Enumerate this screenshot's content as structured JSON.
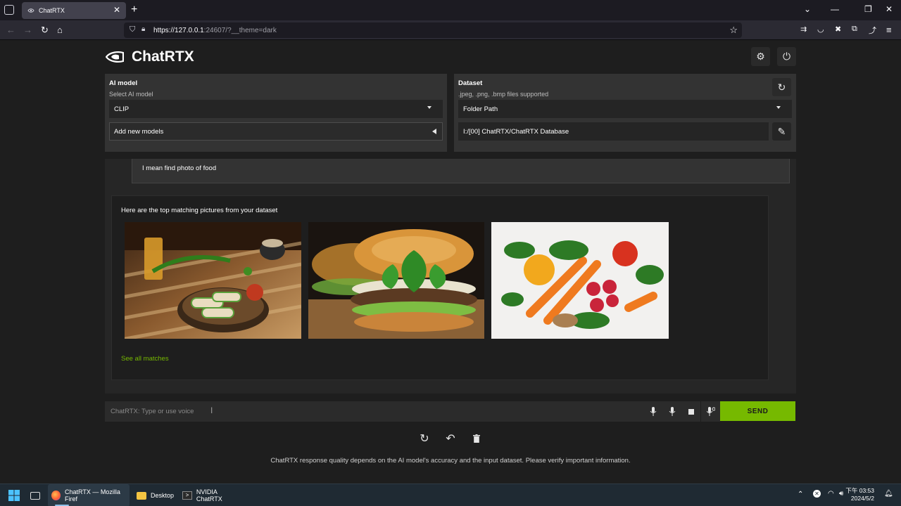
{
  "browser": {
    "tab_title": "ChatRTX",
    "url_host": "https://127.0.0.1",
    "url_rest": ":24607/?__theme=dark"
  },
  "app": {
    "title": "ChatRTX",
    "brand_color": "#76b900"
  },
  "ai_model_panel": {
    "title": "AI model",
    "subtitle": "Select AI model",
    "selected_model": "CLIP",
    "add_models_label": "Add new models"
  },
  "dataset_panel": {
    "title": "Dataset",
    "subtitle": ".jpeg, .png, .bmp files supported",
    "selected_source": "Folder Path",
    "folder_path": "I:/[00] ChatRTX/ChatRTX Database"
  },
  "chat": {
    "user_message": "I mean find photo of food",
    "bot_message": "Here are the top matching pictures from your dataset",
    "see_all_label": "See all matches",
    "input_placeholder": "ChatRTX: Type or use voice",
    "send_label": "SEND"
  },
  "disclaimer": "ChatRTX response quality depends on the AI model's accuracy and the input dataset. Please verify important information.",
  "taskbar": {
    "firefox_label": "ChatRTX — Mozilla Firef",
    "desktop_label": "Desktop",
    "terminal_label": "NVIDIA ChatRTX",
    "clock_time": "下午 03:53",
    "clock_date": "2024/5/2"
  }
}
